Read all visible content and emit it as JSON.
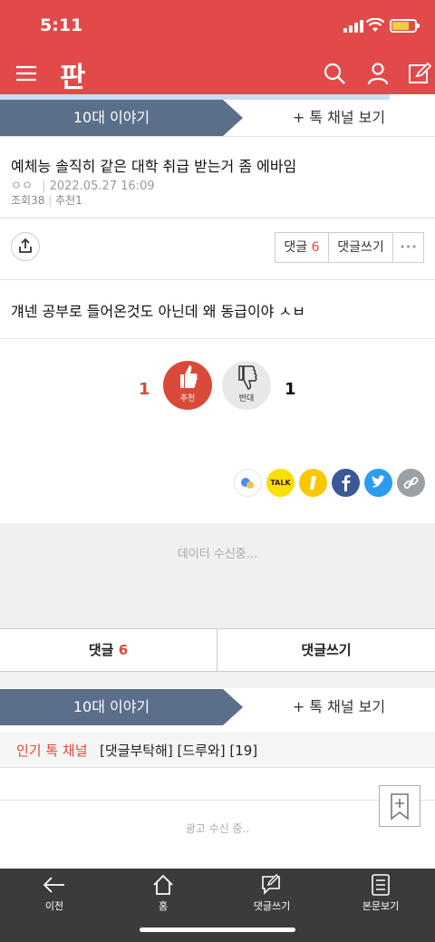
{
  "status": {
    "time": "5:11"
  },
  "header": {
    "logo": "판"
  },
  "channel_nav": {
    "current": "10대 이야기",
    "more": "+ 톡 채널 보기"
  },
  "post": {
    "title": "예체능 솔직히 같은 대학 취급 받는거 좀 에바임",
    "author": "ㅇㅇ",
    "date": "2022.05.27 16:09",
    "views_label": "조회",
    "views": "38",
    "recommend_label": "추천",
    "recommend": "1",
    "body": "걔넨 공부로 들어온것도 아닌데 왜 동급이야 ㅅㅂ"
  },
  "actions": {
    "comment_label": "댓글",
    "comment_count": "6",
    "write_label": "댓글쓰기",
    "more": "•••"
  },
  "vote": {
    "up_count": "1",
    "up_label": "추천",
    "down_label": "반대",
    "down_count": "1"
  },
  "social": {
    "kakao_label": "TALK"
  },
  "loading": {
    "data": "데이터 수신중...",
    "ad": "광고 수신 중.."
  },
  "comment_bar": {
    "comment_label": "댓글",
    "comment_count": "6",
    "write_label": "댓글쓰기"
  },
  "popular": {
    "label": "인기 톡 채널",
    "value": "[댓글부탁해] [드루와] [19]"
  },
  "bottom_nav": [
    {
      "label": "이전",
      "icon": "arrow-left-icon"
    },
    {
      "label": "홈",
      "icon": "home-icon"
    },
    {
      "label": "댓글쓰기",
      "icon": "comment-write-icon"
    },
    {
      "label": "본문보기",
      "icon": "document-icon"
    }
  ],
  "colors": {
    "brand": "#e24a4a",
    "nav": "#5b6e8a",
    "accent": "#d94a3a"
  }
}
